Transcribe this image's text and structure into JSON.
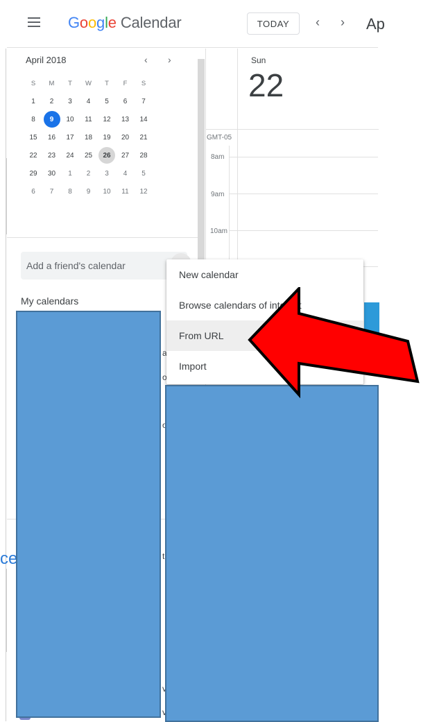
{
  "header": {
    "menu_icon": "hamburger-menu-icon",
    "logo": {
      "letters": [
        "G",
        "o",
        "o",
        "g",
        "l",
        "e"
      ],
      "product": "Calendar"
    },
    "today_label": "TODAY",
    "prev_icon": "chevron-left-icon",
    "next_icon": "chevron-right-icon",
    "prev_glyph": "‹",
    "next_glyph": "›",
    "month_title": "Ap"
  },
  "mini_calendar": {
    "title": "April 2018",
    "prev_glyph": "‹",
    "next_glyph": "›",
    "weekdays": [
      "S",
      "M",
      "T",
      "W",
      "T",
      "F",
      "S"
    ],
    "weeks": [
      [
        "1",
        "2",
        "3",
        "4",
        "5",
        "6",
        "7"
      ],
      [
        "8",
        "9",
        "10",
        "11",
        "12",
        "13",
        "14"
      ],
      [
        "15",
        "16",
        "17",
        "18",
        "19",
        "20",
        "21"
      ],
      [
        "22",
        "23",
        "24",
        "25",
        "26",
        "27",
        "28"
      ],
      [
        "29",
        "30",
        "1",
        "2",
        "3",
        "4",
        "5"
      ],
      [
        "6",
        "7",
        "8",
        "9",
        "10",
        "11",
        "12"
      ]
    ],
    "selected": "9",
    "highlighted": "26"
  },
  "sidebar": {
    "friend_placeholder": "Add a friend's calendar",
    "my_calendars_label": "My calendars",
    "peek_fragments": [
      "ar",
      "ov",
      "o",
      "t",
      "v",
      "v"
    ],
    "link_fragment": "ce"
  },
  "day_view": {
    "day_name": "Sun",
    "day_number": "22",
    "timezone": "GMT-05",
    "hours": [
      "8am",
      "9am",
      "10am"
    ]
  },
  "menu": {
    "items": [
      {
        "label": "New calendar",
        "active": false
      },
      {
        "label": "Browse calendars of interest",
        "active": false
      },
      {
        "label": "From URL",
        "active": true
      },
      {
        "label": "Import",
        "active": false
      }
    ]
  },
  "colors": {
    "accent": "#1a73e8",
    "redaction": "#5b9bd5",
    "arrow": "#ff0000",
    "event": "#2d9ad9"
  }
}
